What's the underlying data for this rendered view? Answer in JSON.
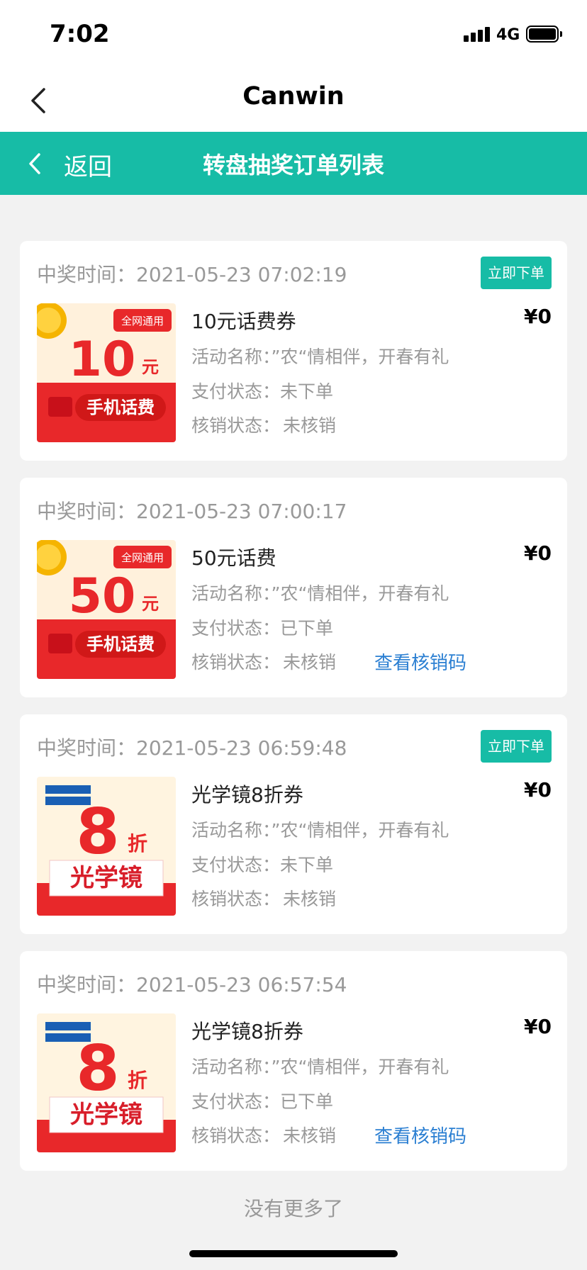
{
  "status_bar": {
    "time": "7:02",
    "network": "4G"
  },
  "navbar": {
    "title": "Canwin"
  },
  "header": {
    "back_label": "返回",
    "title": "转盘抽奖订单列表",
    "color": "#17bca6"
  },
  "orders": [
    {
      "win_time_label": "中奖时间：",
      "win_time": "2021-05-23 07:02:19",
      "order_button": "立即下单",
      "product_name": "10元话费券",
      "price": "¥0",
      "activity_label": "活动名称：",
      "activity": "”农“情相伴，开春有礼",
      "pay_label": "支付状态：",
      "pay_status": "未下单",
      "verify_label": "核销状态：",
      "verify_status": "未核销",
      "thumb": {
        "amount": "10",
        "unit": "元",
        "badge": "全网通用",
        "caption": "手机话费"
      }
    },
    {
      "win_time_label": "中奖时间：",
      "win_time": "2021-05-23 07:00:17",
      "product_name": "50元话费",
      "price": "¥0",
      "activity_label": "活动名称：",
      "activity": "”农“情相伴，开春有礼",
      "pay_label": "支付状态：",
      "pay_status": "已下单",
      "verify_label": "核销状态：",
      "verify_status": "未核销",
      "verify_link": "查看核销码",
      "thumb": {
        "amount": "50",
        "unit": "元",
        "badge": "全网通用",
        "caption": "手机话费"
      }
    },
    {
      "win_time_label": "中奖时间：",
      "win_time": "2021-05-23 06:59:48",
      "order_button": "立即下单",
      "product_name": "光学镜8折券",
      "price": "¥0",
      "activity_label": "活动名称：",
      "activity": "”农“情相伴，开春有礼",
      "pay_label": "支付状态：",
      "pay_status": "未下单",
      "verify_label": "核销状态：",
      "verify_status": "未核销",
      "thumb": {
        "amount": "8",
        "unit": "折",
        "caption": "光学镜"
      }
    },
    {
      "win_time_label": "中奖时间：",
      "win_time": "2021-05-23 06:57:54",
      "product_name": "光学镜8折券",
      "price": "¥0",
      "activity_label": "活动名称：",
      "activity": "”农“情相伴，开春有礼",
      "pay_label": "支付状态：",
      "pay_status": "已下单",
      "verify_label": "核销状态：",
      "verify_status": "未核销",
      "verify_link": "查看核销码",
      "thumb": {
        "amount": "8",
        "unit": "折",
        "caption": "光学镜"
      }
    }
  ],
  "footer": {
    "no_more": "没有更多了"
  }
}
